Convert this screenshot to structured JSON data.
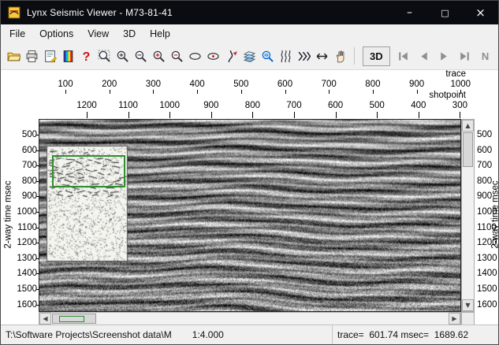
{
  "window": {
    "title": "Lynx Seismic Viewer - M73-81-41",
    "controls": {
      "minimize": "–",
      "maximize": "□",
      "close": "×"
    }
  },
  "menu": {
    "items": [
      "File",
      "Options",
      "View",
      "3D",
      "Help"
    ]
  },
  "toolbar": {
    "buttons": [
      "open-file",
      "print",
      "export-image",
      "colorbar",
      "help",
      "zoom-window",
      "zoom-in",
      "zoom-out",
      "zoom-in-fixed",
      "zoom-out-fixed",
      "ellipse-tool",
      "ellipse-pick",
      "pick-curve",
      "horizon-flatten",
      "trace-magnify",
      "wiggle-traces",
      "trace-step",
      "fit-width",
      "pan-hand"
    ],
    "threed_label": "3D",
    "nav_buttons": [
      "first",
      "previous",
      "next",
      "last",
      "n-toggle"
    ],
    "n_label": "N"
  },
  "axes": {
    "trace": {
      "label": "trace",
      "ticks": [
        100,
        200,
        300,
        400,
        500,
        600,
        700,
        800,
        900,
        1000
      ]
    },
    "shotpoint": {
      "label": "shotpoint",
      "ticks": [
        1200,
        1100,
        1000,
        900,
        800,
        700,
        600,
        500,
        400,
        300
      ]
    },
    "time": {
      "label": "2-way time msec",
      "ticks": [
        500,
        600,
        700,
        800,
        900,
        1000,
        1100,
        1200,
        1300,
        1400,
        1500,
        1600
      ]
    }
  },
  "statusbar": {
    "path": "T:\\Software Projects\\Screenshot data\\M",
    "scale": "1:4.000",
    "readout": "trace=  601.74 msec=  1689.62"
  },
  "colors": {
    "accent_green": "#2d8f2d",
    "help_red": "#cc1111",
    "titlebar": "#0b0b12"
  }
}
